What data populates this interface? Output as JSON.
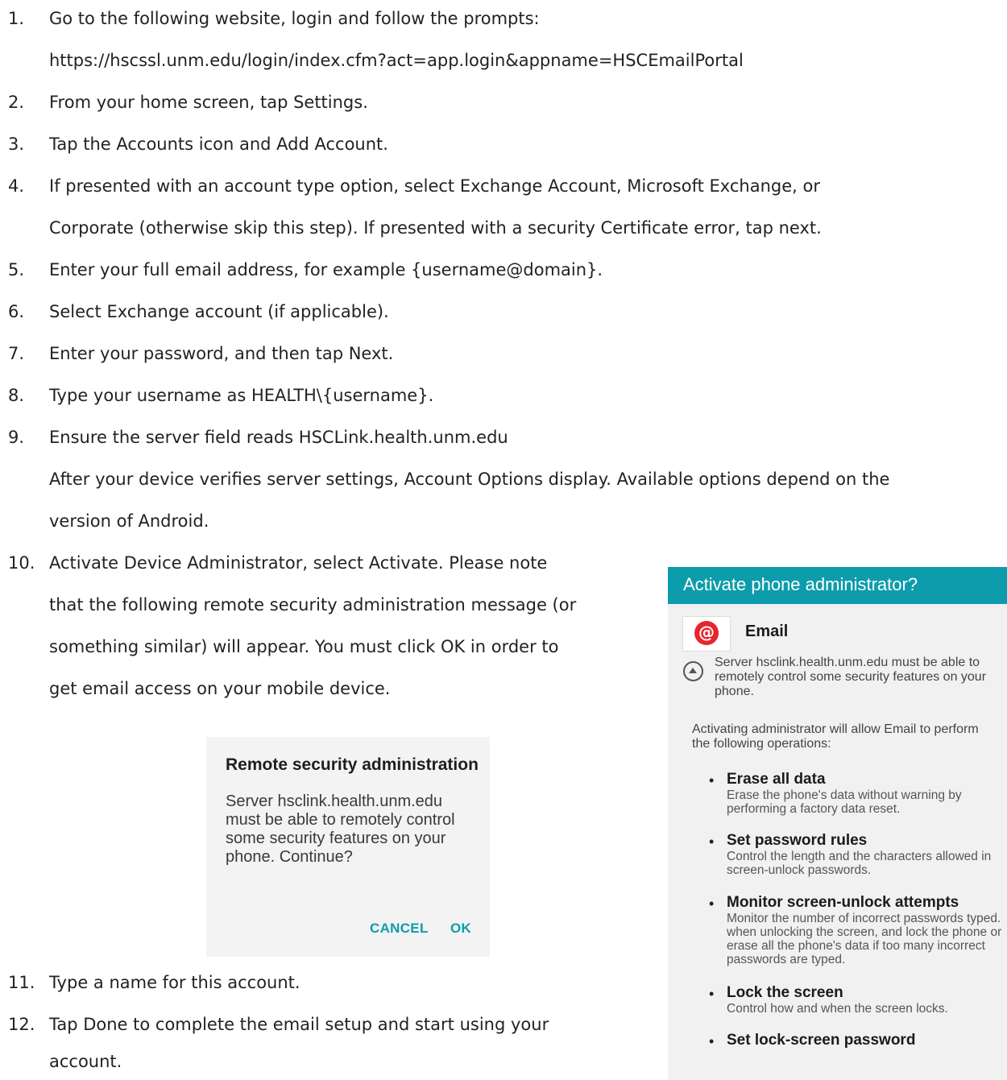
{
  "steps": [
    {
      "num": "1.",
      "lines": [
        "Go to the following website, login and follow the prompts:",
        "https://hscssl.unm.edu/login/index.cfm?act=app.login&appname=HSCEmailPortal"
      ]
    },
    {
      "num": "2.",
      "lines": [
        "From your home screen, tap Settings."
      ]
    },
    {
      "num": "3.",
      "lines": [
        "Tap the Accounts icon and Add Account."
      ]
    },
    {
      "num": "4.",
      "lines": [
        "If presented with an account type option, select Exchange Account, Microsoft Exchange, or",
        "Corporate (otherwise skip this step). If presented with a security Certificate error, tap next."
      ]
    },
    {
      "num": "5.",
      "lines": [
        "Enter your full email address, for example {username@domain}."
      ]
    },
    {
      "num": "6.",
      "lines": [
        "Select Exchange account (if applicable)."
      ]
    },
    {
      "num": "7.",
      "lines": [
        "Enter your password, and then tap Next."
      ]
    },
    {
      "num": "8.",
      "lines": [
        "Type your username as HEALTH\\{username}."
      ]
    },
    {
      "num": "9.",
      "lines": [
        "Ensure the server field reads HSCLink.health.unm.edu",
        "After your device verifies server settings, Account Options display. Available options depend on the",
        "version of Android."
      ]
    },
    {
      "num": "10.",
      "lines": [
        "Activate Device Administrator, select Activate. Please note",
        "that the following remote security administration message (or",
        "something similar) will appear. You must click OK in order to",
        "get email access on your mobile device."
      ]
    },
    {
      "num": "11.",
      "lines": [
        "Type a name for this account."
      ]
    },
    {
      "num": "12.",
      "lines": [
        "Tap Done to complete the email setup and start using your",
        "account."
      ]
    }
  ],
  "dialog": {
    "title": "Remote security administration",
    "body": "Server hsclink.health.unm.edu must be able to remotely control some security features on your phone. Continue?",
    "cancel": "CANCEL",
    "ok": "OK"
  },
  "phone_admin": {
    "header": "Activate phone administrator?",
    "app_icon_symbol": "@",
    "app_name": "Email",
    "server_text": "Server hsclink.health.unm.edu must be able to remotely control some security features on your phone.",
    "intro": "Activating administrator will allow Email to perform the following operations:",
    "permissions": [
      {
        "title": "Erase all data",
        "desc": "Erase the phone's data without warning by performing a factory data reset."
      },
      {
        "title": "Set password rules",
        "desc": "Control the length and the characters allowed in screen-unlock passwords."
      },
      {
        "title": "Monitor screen-unlock attempts",
        "desc": "Monitor the number of incorrect passwords typed. when unlocking the screen, and lock the phone or erase all the phone's data if too many incorrect passwords are typed."
      },
      {
        "title": "Lock the screen",
        "desc": "Control how and when the screen locks."
      },
      {
        "title": "Set lock-screen password",
        "desc": ""
      }
    ],
    "colors": {
      "header": "#0d9cab",
      "button": "#0d9cab",
      "badge": "#e8242f"
    }
  }
}
